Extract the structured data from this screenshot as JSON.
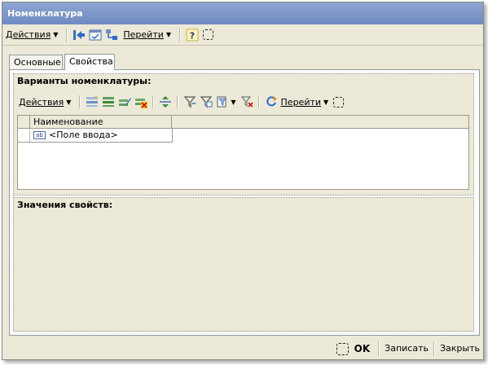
{
  "window": {
    "title": "Номенклатура"
  },
  "toolbar": {
    "actions_label": "Действия",
    "goto_label": "Перейти",
    "help_label": "?"
  },
  "tabs": [
    {
      "label": "Основные",
      "active": false
    },
    {
      "label": "Свойства",
      "active": true
    }
  ],
  "variants": {
    "title": "Варианты номенклатуры:",
    "actions_label": "Действия",
    "goto_label": "Перейти",
    "columns": [
      "Наименование"
    ],
    "rows": [
      {
        "field_icon": "ab",
        "value": "<Поле ввода>"
      }
    ]
  },
  "properties": {
    "title": "Значения свойств:"
  },
  "buttons": {
    "ok": "OK",
    "save": "Записать",
    "close": "Закрыть"
  }
}
